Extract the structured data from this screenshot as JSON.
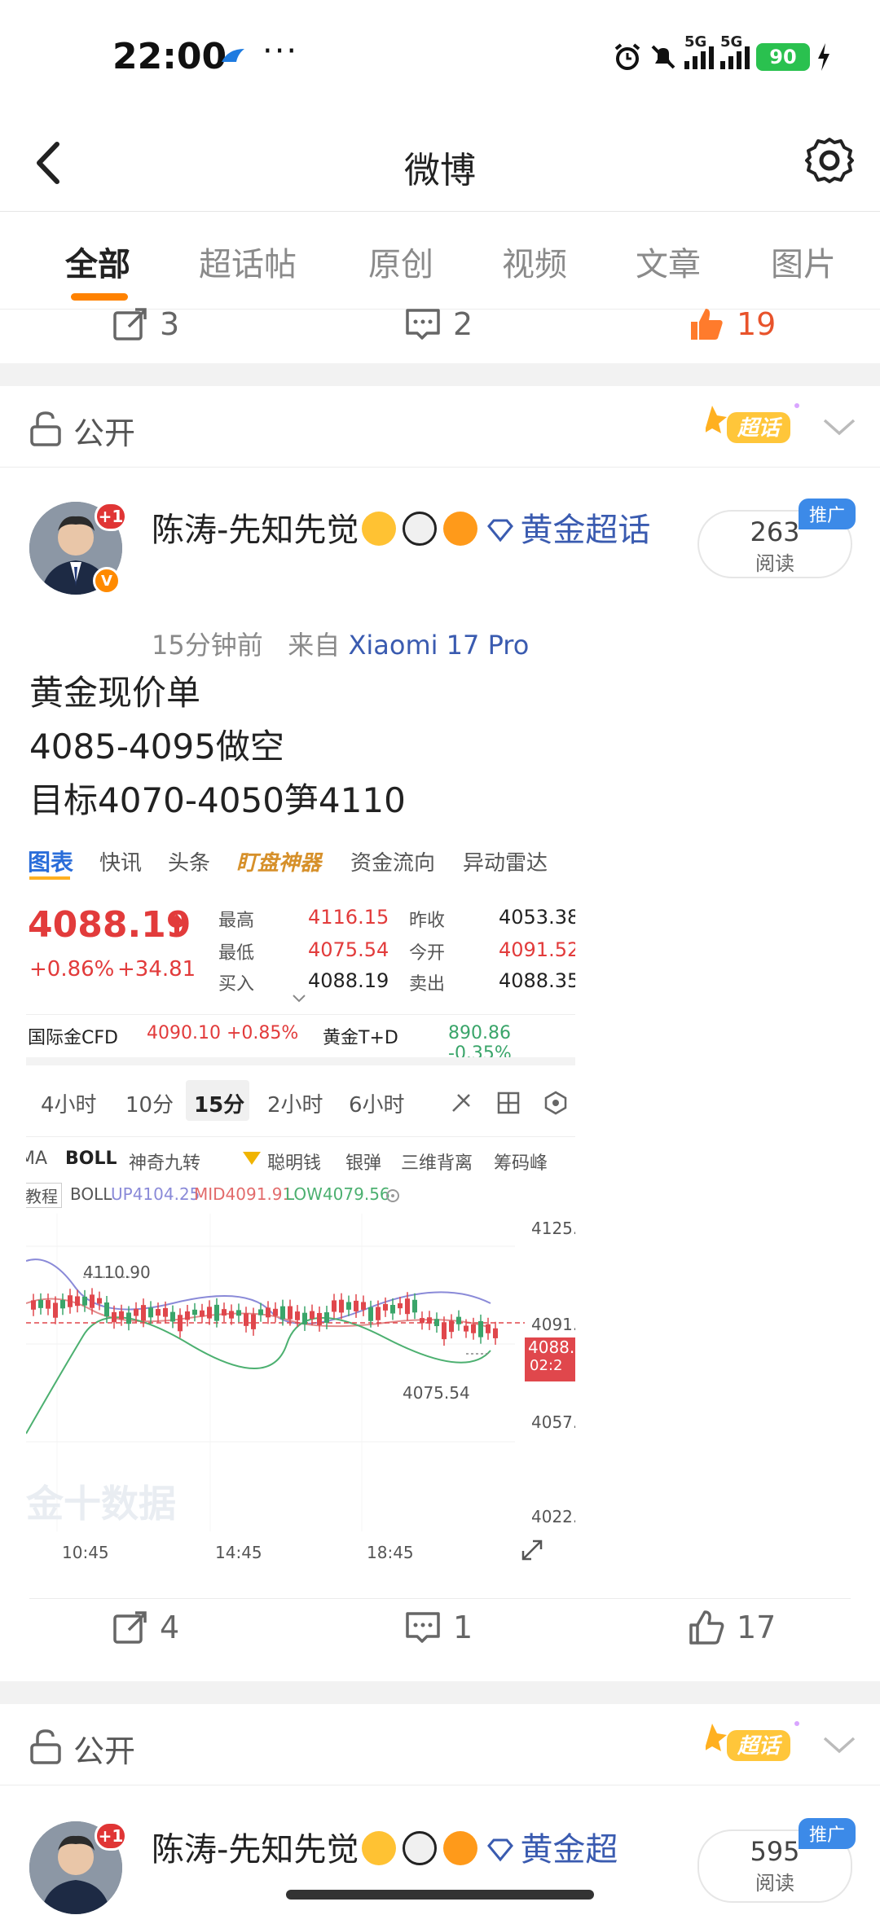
{
  "status": {
    "time": "22:00",
    "more": "···",
    "sig1": "5G",
    "sig2": "5G",
    "battery": "90"
  },
  "header": {
    "title": "微博"
  },
  "tabs": [
    {
      "label": "全部"
    },
    {
      "label": "超话帖"
    },
    {
      "label": "原创"
    },
    {
      "label": "视频"
    },
    {
      "label": "文章"
    },
    {
      "label": "图片"
    }
  ],
  "prev_post": {
    "reposts": "3",
    "comments": "2",
    "likes": "19"
  },
  "post1": {
    "visibility": "公开",
    "chaohua_tag": "超话",
    "avatar_badge": "+1",
    "username": "陈涛-先知先觉",
    "gold_tag": "黄金超话",
    "reads": "263",
    "reads_label": "阅读",
    "promo": "推广",
    "time": "15分钟前",
    "from": "来自",
    "device": "Xiaomi 17 Pro",
    "text_lines": [
      "黄金现价单",
      "4085-4095做空",
      "目标4070-4050笋4110"
    ],
    "reposts": "4",
    "comments": "1",
    "likes": "17"
  },
  "chart_shot": {
    "tabs": [
      "图表",
      "快讯",
      "头条",
      "盯盘神器",
      "资金流向",
      "异动雷达"
    ],
    "price": "4088.19",
    "change_pct": "+0.86%",
    "change_abs": "+34.81",
    "labels": [
      "最高",
      "最低",
      "买入",
      "昨收",
      "今开",
      "卖出"
    ],
    "values": [
      "4116.15",
      "4075.54",
      "4088.19",
      "4053.38",
      "4091.52",
      "4088.35"
    ],
    "cfd_label": "国际金CFD",
    "cfd_value": "4090.10 +0.85%",
    "td_label": "黄金T+D",
    "td_value": "890.86 -0.35%",
    "periods": [
      "4小时",
      "10分",
      "15分",
      "2小时",
      "6小时"
    ],
    "indicators": [
      "MA",
      "BOLL",
      "神奇九转",
      "聪明钱",
      "银弹",
      "三维背离",
      "筹码峰"
    ],
    "tutorial": "教程",
    "boll_label": "BOLL",
    "boll_up": "UP4104.25",
    "boll_mid": "MID4091.91",
    "boll_low": "LOW4079.56",
    "y_ticks": [
      "4125.",
      "4091.",
      "4057.",
      "4022."
    ],
    "x_ticks": [
      "10:45",
      "14:45",
      "18:45"
    ],
    "high_marker": "4110.90",
    "low_marker": "4075.54",
    "price_tag": "4088.",
    "price_tag_time": "02:2",
    "watermark": "金十数据"
  },
  "post2": {
    "visibility": "公开",
    "chaohua_tag": "超话",
    "avatar_badge": "+1",
    "username": "陈涛-先知先觉",
    "gold_tag": "黄金超",
    "reads": "595",
    "reads_label": "阅读",
    "promo": "推广"
  },
  "colors": {
    "accent": "#ff8200",
    "link": "#3a5bb0",
    "up": "#e23b3b",
    "down": "#3aa56a"
  }
}
